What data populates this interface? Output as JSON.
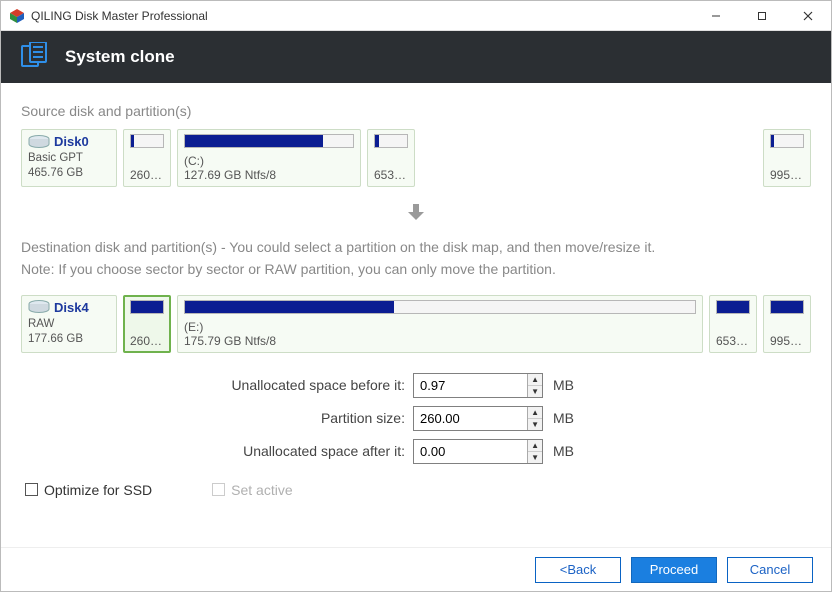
{
  "titlebar": {
    "title": "QILING Disk Master Professional"
  },
  "header": {
    "title": "System clone"
  },
  "source": {
    "label": "Source disk and partition(s)",
    "disk": {
      "name": "Disk0",
      "type": "Basic GPT",
      "size": "465.76 GB"
    },
    "partitions": [
      {
        "letter": "",
        "label": "260…",
        "fill_pct": 8
      },
      {
        "letter": "(C:)",
        "label": "127.69 GB Ntfs/8",
        "fill_pct": 82
      },
      {
        "letter": "",
        "label": "653…",
        "fill_pct": 12
      },
      {
        "letter": "",
        "label": "995…",
        "fill_pct": 10
      }
    ]
  },
  "destinationNote": {
    "line1": "Destination disk and partition(s) - You could select a partition on the disk map, and then move/resize it.",
    "line2": "Note: If you choose sector by sector or RAW partition, you can only move the partition."
  },
  "destination": {
    "disk": {
      "name": "Disk4",
      "type": "RAW",
      "size": "177.66 GB"
    },
    "partitions": [
      {
        "letter": "",
        "label": "260…",
        "fill_pct": 100,
        "selected": true
      },
      {
        "letter": "(E:)",
        "label": "175.79 GB Ntfs/8",
        "fill_pct": 41
      },
      {
        "letter": "",
        "label": "653…",
        "fill_pct": 100
      },
      {
        "letter": "",
        "label": "995…",
        "fill_pct": 100
      }
    ]
  },
  "form": {
    "before": {
      "label": "Unallocated space before it:",
      "value": "0.97",
      "unit": "MB"
    },
    "size": {
      "label": "Partition size:",
      "value": "260.00",
      "unit": "MB"
    },
    "after": {
      "label": "Unallocated space after it:",
      "value": "0.00",
      "unit": "MB"
    }
  },
  "options": {
    "ssd": "Optimize for SSD",
    "setactive": "Set active"
  },
  "footer": {
    "back": "<Back",
    "proceed": "Proceed",
    "cancel": "Cancel"
  }
}
